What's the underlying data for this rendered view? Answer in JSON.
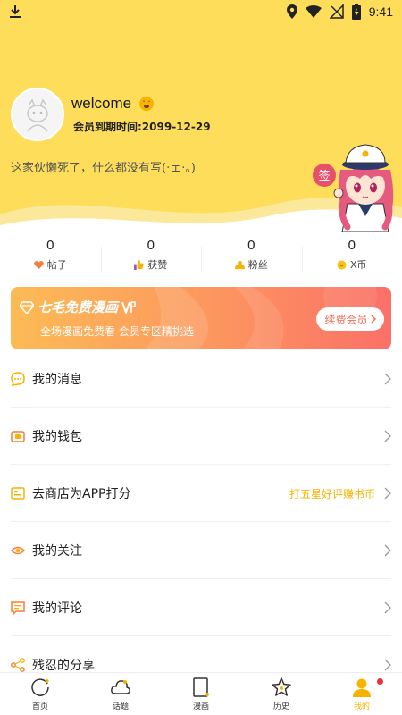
{
  "status_bar": {
    "time": "9:41"
  },
  "profile": {
    "username": "welcome",
    "vip_expire": "会员到期时间:2099-12-29",
    "bio": "这家伙懒死了，什么都没有写(·ェ·。)",
    "mascot_sign": "签"
  },
  "stats": [
    {
      "value": "0",
      "label": "帖子",
      "icon": "heart-icon",
      "color": "#f57c3a"
    },
    {
      "value": "0",
      "label": "获赞",
      "icon": "thumbs-up-icon",
      "color": "#f5b400"
    },
    {
      "value": "0",
      "label": "粉丝",
      "icon": "fans-icon",
      "color": "#f5b400"
    },
    {
      "value": "0",
      "label": "X币",
      "icon": "coin-icon",
      "color": "#f5c518"
    }
  ],
  "banner": {
    "title": "七毛免费漫画",
    "subtitle": "全场漫画免费看 会员专区精挑选",
    "button": "续费会员"
  },
  "menu": [
    {
      "label": "我的消息",
      "icon": "message-icon",
      "extra": ""
    },
    {
      "label": "我的钱包",
      "icon": "wallet-icon",
      "extra": ""
    },
    {
      "label": "去商店为APP打分",
      "icon": "rate-icon",
      "extra": "打五星好评赚书币"
    },
    {
      "label": "我的关注",
      "icon": "eye-icon",
      "extra": ""
    },
    {
      "label": "我的评论",
      "icon": "comment-icon",
      "extra": ""
    },
    {
      "label": "残忍的分享",
      "icon": "share-icon",
      "extra": ""
    }
  ],
  "nav": [
    {
      "label": "首页",
      "icon": "home-icon",
      "active": false
    },
    {
      "label": "话题",
      "icon": "topic-icon",
      "active": false
    },
    {
      "label": "漫画",
      "icon": "comic-icon",
      "active": false
    },
    {
      "label": "历史",
      "icon": "history-icon",
      "active": false
    },
    {
      "label": "我的",
      "icon": "profile-icon",
      "active": true
    }
  ],
  "colors": {
    "header_yellow": "#fddd59",
    "accent": "#f5b400",
    "banner_start": "#fcbb55",
    "banner_end": "#fb7068"
  }
}
